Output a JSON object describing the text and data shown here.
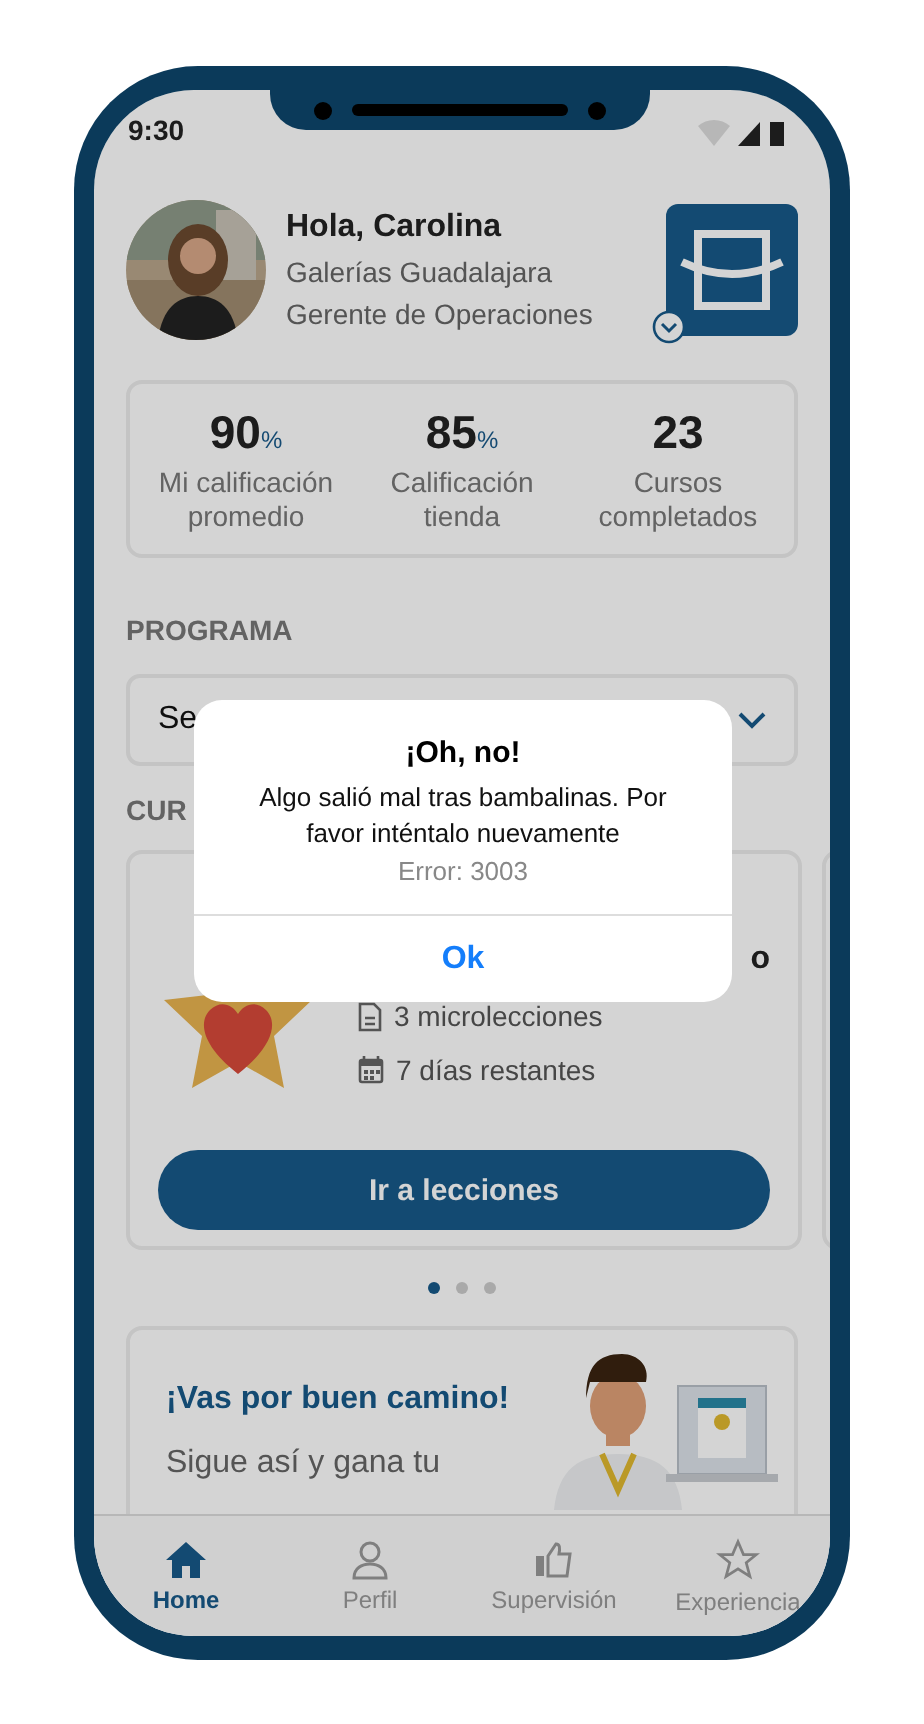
{
  "status_bar": {
    "time": "9:30"
  },
  "profile": {
    "greeting": "Hola, Carolina",
    "store": "Galerías Guadalajara",
    "role": "Gerente de Operaciones"
  },
  "stats": [
    {
      "value": "90",
      "unit": "%",
      "label": "Mi calificación promedio"
    },
    {
      "value": "85",
      "unit": "%",
      "label": "Calificación tienda"
    },
    {
      "value": "23",
      "label": "Cursos completados"
    }
  ],
  "program": {
    "heading": "PROGRAMA",
    "value": "Se"
  },
  "courses": {
    "heading": "CUR",
    "card": {
      "title_tail": "o",
      "meta": [
        {
          "kind": "lessons",
          "text": "3 microlecciones"
        },
        {
          "kind": "days",
          "text": "7 días restantes"
        }
      ],
      "button": "Ir a lecciones"
    },
    "dots": [
      {
        "selected": true
      },
      {
        "selected": false
      },
      {
        "selected": false
      }
    ]
  },
  "promo": {
    "title": "¡Vas por buen camino!",
    "text": "Sigue así y gana tu"
  },
  "nav": [
    {
      "kind": "home",
      "label": "Home",
      "selected": true
    },
    {
      "kind": "profile",
      "label": "Perfil",
      "selected": false
    },
    {
      "kind": "thumb",
      "label": "Supervisión",
      "selected": false
    },
    {
      "kind": "star",
      "label": "Experiencia",
      "selected": false
    }
  ],
  "dialog": {
    "title": "¡Oh, no!",
    "message": "Algo salió mal tras bambalinas. Por favor inténtalo nuevamente",
    "error": "Error: 3003",
    "button": "Ok"
  }
}
